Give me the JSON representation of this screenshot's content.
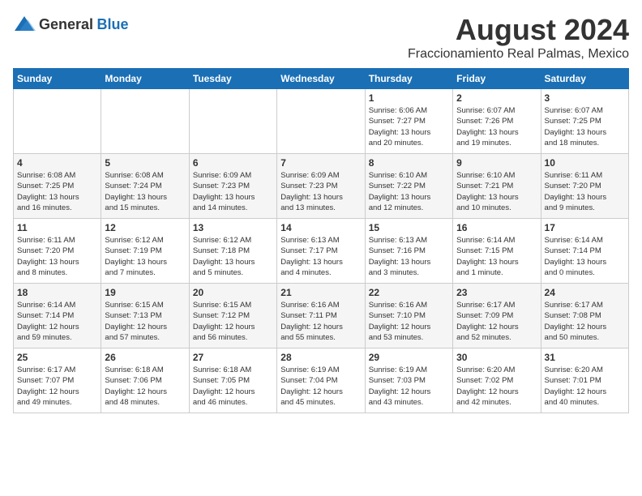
{
  "logo": {
    "general": "General",
    "blue": "Blue"
  },
  "title": "August 2024",
  "subtitle": "Fraccionamiento Real Palmas, Mexico",
  "days_of_week": [
    "Sunday",
    "Monday",
    "Tuesday",
    "Wednesday",
    "Thursday",
    "Friday",
    "Saturday"
  ],
  "weeks": [
    [
      {
        "day": "",
        "info": ""
      },
      {
        "day": "",
        "info": ""
      },
      {
        "day": "",
        "info": ""
      },
      {
        "day": "",
        "info": ""
      },
      {
        "day": "1",
        "info": "Sunrise: 6:06 AM\nSunset: 7:27 PM\nDaylight: 13 hours\nand 20 minutes."
      },
      {
        "day": "2",
        "info": "Sunrise: 6:07 AM\nSunset: 7:26 PM\nDaylight: 13 hours\nand 19 minutes."
      },
      {
        "day": "3",
        "info": "Sunrise: 6:07 AM\nSunset: 7:25 PM\nDaylight: 13 hours\nand 18 minutes."
      }
    ],
    [
      {
        "day": "4",
        "info": "Sunrise: 6:08 AM\nSunset: 7:25 PM\nDaylight: 13 hours\nand 16 minutes."
      },
      {
        "day": "5",
        "info": "Sunrise: 6:08 AM\nSunset: 7:24 PM\nDaylight: 13 hours\nand 15 minutes."
      },
      {
        "day": "6",
        "info": "Sunrise: 6:09 AM\nSunset: 7:23 PM\nDaylight: 13 hours\nand 14 minutes."
      },
      {
        "day": "7",
        "info": "Sunrise: 6:09 AM\nSunset: 7:23 PM\nDaylight: 13 hours\nand 13 minutes."
      },
      {
        "day": "8",
        "info": "Sunrise: 6:10 AM\nSunset: 7:22 PM\nDaylight: 13 hours\nand 12 minutes."
      },
      {
        "day": "9",
        "info": "Sunrise: 6:10 AM\nSunset: 7:21 PM\nDaylight: 13 hours\nand 10 minutes."
      },
      {
        "day": "10",
        "info": "Sunrise: 6:11 AM\nSunset: 7:20 PM\nDaylight: 13 hours\nand 9 minutes."
      }
    ],
    [
      {
        "day": "11",
        "info": "Sunrise: 6:11 AM\nSunset: 7:20 PM\nDaylight: 13 hours\nand 8 minutes."
      },
      {
        "day": "12",
        "info": "Sunrise: 6:12 AM\nSunset: 7:19 PM\nDaylight: 13 hours\nand 7 minutes."
      },
      {
        "day": "13",
        "info": "Sunrise: 6:12 AM\nSunset: 7:18 PM\nDaylight: 13 hours\nand 5 minutes."
      },
      {
        "day": "14",
        "info": "Sunrise: 6:13 AM\nSunset: 7:17 PM\nDaylight: 13 hours\nand 4 minutes."
      },
      {
        "day": "15",
        "info": "Sunrise: 6:13 AM\nSunset: 7:16 PM\nDaylight: 13 hours\nand 3 minutes."
      },
      {
        "day": "16",
        "info": "Sunrise: 6:14 AM\nSunset: 7:15 PM\nDaylight: 13 hours\nand 1 minute."
      },
      {
        "day": "17",
        "info": "Sunrise: 6:14 AM\nSunset: 7:14 PM\nDaylight: 13 hours\nand 0 minutes."
      }
    ],
    [
      {
        "day": "18",
        "info": "Sunrise: 6:14 AM\nSunset: 7:14 PM\nDaylight: 12 hours\nand 59 minutes."
      },
      {
        "day": "19",
        "info": "Sunrise: 6:15 AM\nSunset: 7:13 PM\nDaylight: 12 hours\nand 57 minutes."
      },
      {
        "day": "20",
        "info": "Sunrise: 6:15 AM\nSunset: 7:12 PM\nDaylight: 12 hours\nand 56 minutes."
      },
      {
        "day": "21",
        "info": "Sunrise: 6:16 AM\nSunset: 7:11 PM\nDaylight: 12 hours\nand 55 minutes."
      },
      {
        "day": "22",
        "info": "Sunrise: 6:16 AM\nSunset: 7:10 PM\nDaylight: 12 hours\nand 53 minutes."
      },
      {
        "day": "23",
        "info": "Sunrise: 6:17 AM\nSunset: 7:09 PM\nDaylight: 12 hours\nand 52 minutes."
      },
      {
        "day": "24",
        "info": "Sunrise: 6:17 AM\nSunset: 7:08 PM\nDaylight: 12 hours\nand 50 minutes."
      }
    ],
    [
      {
        "day": "25",
        "info": "Sunrise: 6:17 AM\nSunset: 7:07 PM\nDaylight: 12 hours\nand 49 minutes."
      },
      {
        "day": "26",
        "info": "Sunrise: 6:18 AM\nSunset: 7:06 PM\nDaylight: 12 hours\nand 48 minutes."
      },
      {
        "day": "27",
        "info": "Sunrise: 6:18 AM\nSunset: 7:05 PM\nDaylight: 12 hours\nand 46 minutes."
      },
      {
        "day": "28",
        "info": "Sunrise: 6:19 AM\nSunset: 7:04 PM\nDaylight: 12 hours\nand 45 minutes."
      },
      {
        "day": "29",
        "info": "Sunrise: 6:19 AM\nSunset: 7:03 PM\nDaylight: 12 hours\nand 43 minutes."
      },
      {
        "day": "30",
        "info": "Sunrise: 6:20 AM\nSunset: 7:02 PM\nDaylight: 12 hours\nand 42 minutes."
      },
      {
        "day": "31",
        "info": "Sunrise: 6:20 AM\nSunset: 7:01 PM\nDaylight: 12 hours\nand 40 minutes."
      }
    ]
  ]
}
